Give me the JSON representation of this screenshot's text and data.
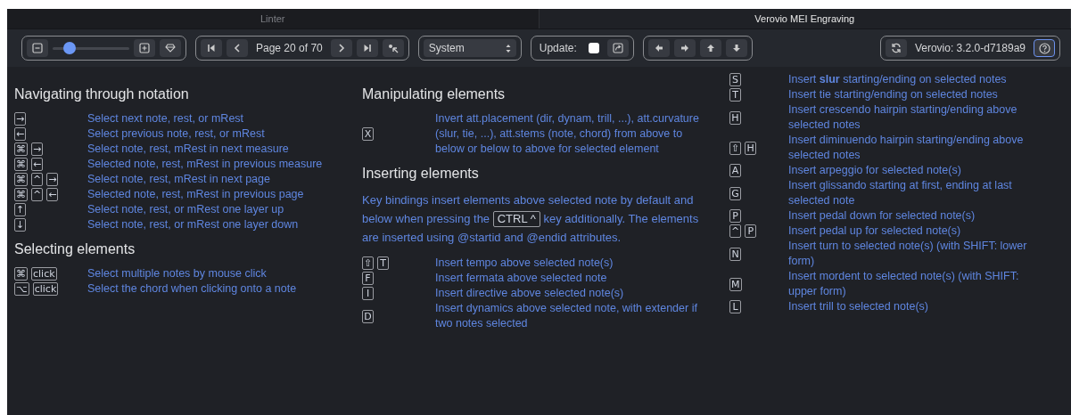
{
  "tabs": [
    {
      "label": "Linter",
      "selected": false
    },
    {
      "label": "Verovio MEI Engraving",
      "selected": true
    }
  ],
  "toolbar": {
    "zoom": {
      "level": 0.22
    },
    "page_label": "Page 20 of 70",
    "view_select": {
      "value": "System"
    },
    "update": {
      "label": "Update:",
      "checked": false
    },
    "version": "Verovio: 3.2.0-d7189a9",
    "help_button": {
      "focused": true
    }
  },
  "columns": [
    {
      "sections": [
        {
          "title": "Navigating through notation",
          "rows": [
            {
              "keys": [
                "→"
              ],
              "text": "Select next note, rest, or mRest"
            },
            {
              "keys": [
                "←"
              ],
              "text": "Select previous note, rest, or mRest"
            },
            {
              "keys": [
                "⌘",
                "→"
              ],
              "text": "Select note, rest, mRest in next measure"
            },
            {
              "keys": [
                "⌘",
                "←"
              ],
              "text": "Selected note, rest, mRest in previous measure"
            },
            {
              "keys": [
                "⌘",
                "^",
                "→"
              ],
              "text": "Select note, rest, mRest in next page"
            },
            {
              "keys": [
                "⌘",
                "^",
                "←"
              ],
              "text": "Selected note, rest, mRest in previous page"
            },
            {
              "keys": [
                "↑"
              ],
              "text": "Select note, rest, or mRest one layer up"
            },
            {
              "keys": [
                "↓"
              ],
              "text": "Select note, rest, or mRest one layer down"
            }
          ]
        },
        {
          "title": "Selecting elements",
          "rows": [
            {
              "keys": [
                "⌘",
                "click"
              ],
              "text": "Select multiple notes by mouse click"
            },
            {
              "keys": [
                "⌥",
                "click"
              ],
              "text": "Select the chord when clicking onto a note"
            }
          ]
        }
      ]
    },
    {
      "sections": [
        {
          "title": "Manipulating elements",
          "rows": [
            {
              "keys": [
                "X"
              ],
              "text": "Invert att.placement (dir, dynam, trill, ...), att.curvature (slur, tie, ...), att.stems (note, chord) from above to below or below to above for selected element"
            }
          ]
        },
        {
          "title": "Inserting elements",
          "intro": {
            "before": "Key bindings insert elements above selected note by default and below when pressing the",
            "key": "CTRL ^",
            "after": "key additionally. The elements are inserted using @startid and @endid attributes."
          },
          "rows": [
            {
              "keys": [
                "⇧",
                "T"
              ],
              "text": "Insert tempo above selected note(s)"
            },
            {
              "keys": [
                "F"
              ],
              "text": "Insert fermata above selected note"
            },
            {
              "keys": [
                "I"
              ],
              "text": "Insert directive above selected note(s)"
            },
            {
              "keys": [
                "D"
              ],
              "text": "Insert dynamics above selected note, with extender if two notes selected"
            }
          ]
        }
      ]
    },
    {
      "sections": [
        {
          "rows": [
            {
              "keys": [
                "S"
              ],
              "text": "Insert **slur** starting/ending on selected notes"
            },
            {
              "keys": [
                "T"
              ],
              "text": "Insert tie starting/ending on selected notes"
            },
            {
              "keys": [
                "H"
              ],
              "text": "Insert crescendo hairpin starting/ending above selected notes"
            },
            {
              "keys": [
                "⇧",
                "H"
              ],
              "text": "Insert diminuendo hairpin starting/ending above selected notes"
            },
            {
              "keys": [
                "A"
              ],
              "text": "Insert arpeggio for selected note(s)"
            },
            {
              "keys": [
                "G"
              ],
              "text": "Insert glissando starting at first, ending at last selected note"
            },
            {
              "keys": [
                "P"
              ],
              "text": "Insert pedal down for selected note(s)"
            },
            {
              "keys": [
                "^",
                "P"
              ],
              "text": "Insert pedal up for selected note(s)"
            },
            {
              "keys": [
                "N"
              ],
              "text": "Insert turn to selected note(s) (with SHIFT: lower form)"
            },
            {
              "keys": [
                "M"
              ],
              "text": "Insert mordent to selected note(s) (with SHIFT: upper form)"
            },
            {
              "keys": [
                "L"
              ],
              "text": "Insert trill to selected note(s)"
            }
          ]
        }
      ]
    }
  ]
}
